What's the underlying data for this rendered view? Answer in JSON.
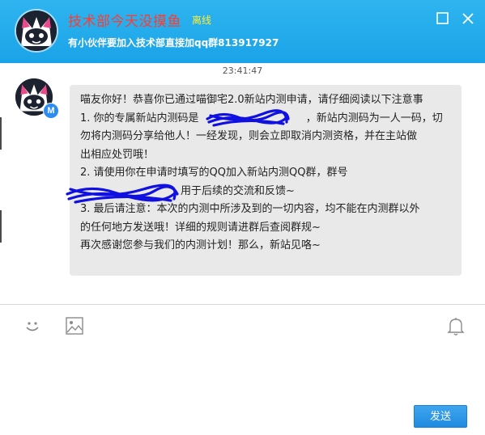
{
  "header": {
    "contact_name": "技术部今天没摸鱼",
    "status": "离线",
    "signature": "有小伙伴要加入技术部直接加qq群813917927",
    "avatar_icon": "mascot-avatar-icon",
    "maximize_icon": "maximize-icon",
    "close_icon": "close-icon"
  },
  "chat": {
    "timestamp": "23:41:47",
    "message": {
      "sender_badge": "M",
      "lines": [
        "喵友你好！恭喜你已通过喵御宅2.0新站内测申请，请仔细阅读以下注意事",
        "1. 你的专属新站内测码是                                ，新站内测码为一人一码，切",
        "勿将内测码分享给他人！一经发现，则会立即取消内测资格，并在主站做",
        "出相应处罚哦！",
        "2. 请使用你在申请时填写的QQ加入新站内测QQ群，群号",
        "                              用于后续的交流和反馈~",
        "3. 最后请注意：本次的内测中所涉及到的一切内容，均不能在内测群以外",
        "的任何地方发送哦！详细的规则请进群后查阅群规~",
        "再次感谢您参与我们的内测计划！那么，新站见咯~"
      ]
    }
  },
  "toolbar": {
    "emoji_icon": "smiley-icon",
    "image_icon": "image-icon",
    "bell_icon": "bell-icon"
  },
  "composer": {
    "input_value": "",
    "send_label": "发送"
  },
  "colors": {
    "header_bg": "#1aa3e8",
    "name_color": "#ff3b30",
    "status_color": "#ffee33",
    "bubble_bg": "#e9e9e9",
    "send_bg": "#1f8be0"
  }
}
